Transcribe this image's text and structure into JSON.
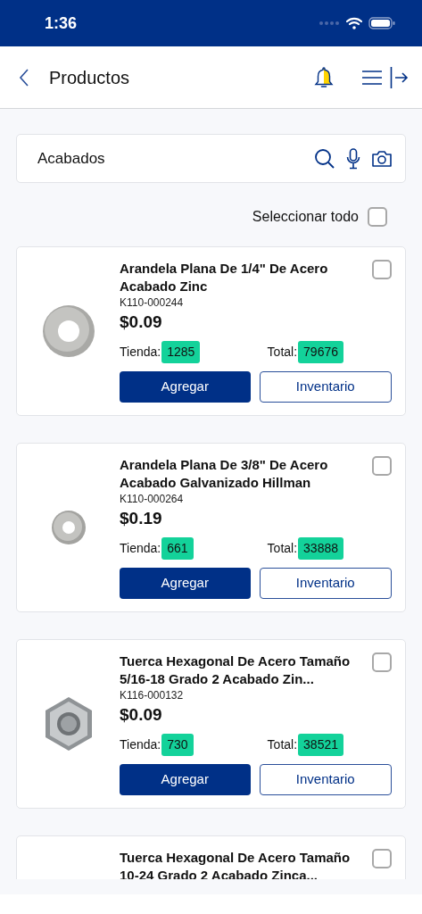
{
  "status_bar": {
    "time": "1:36"
  },
  "header": {
    "title": "Productos"
  },
  "search": {
    "value": "Acabados"
  },
  "select_all": {
    "label": "Seleccionar todo",
    "checked": false
  },
  "products": [
    {
      "name": "Arandela Plana De 1/4\" De Acero Acabado Zinc",
      "sku": "K110-000244",
      "price": "$0.09",
      "store_label": "Tienda:",
      "store_qty": "1285",
      "total_label": "Total:",
      "total_qty": "79676",
      "add_button": "Agregar",
      "inventory_button": "Inventario",
      "checked": false,
      "image": {
        "kind": "washer"
      }
    },
    {
      "name": "Arandela Plana De 3/8\" De Acero Acabado Galvanizado Hillman",
      "sku": "K110-000264",
      "price": "$0.19",
      "store_label": "Tienda:",
      "store_qty": "661",
      "total_label": "Total:",
      "total_qty": "33888",
      "add_button": "Agregar",
      "inventory_button": "Inventario",
      "checked": false,
      "image": {
        "kind": "small-washer"
      }
    },
    {
      "name": "Tuerca Hexagonal De Acero Tamaño 5/16-18 Grado 2 Acabado Zin...",
      "sku": "K116-000132",
      "price": "$0.09",
      "store_label": "Tienda:",
      "store_qty": "730",
      "total_label": "Total:",
      "total_qty": "38521",
      "add_button": "Agregar",
      "inventory_button": "Inventario",
      "checked": false,
      "image": {
        "kind": "nut"
      }
    },
    {
      "name": "Tuerca Hexagonal De Acero Tamaño 10-24 Grado 2 Acabado Zinca...",
      "checked": false
    }
  ]
}
